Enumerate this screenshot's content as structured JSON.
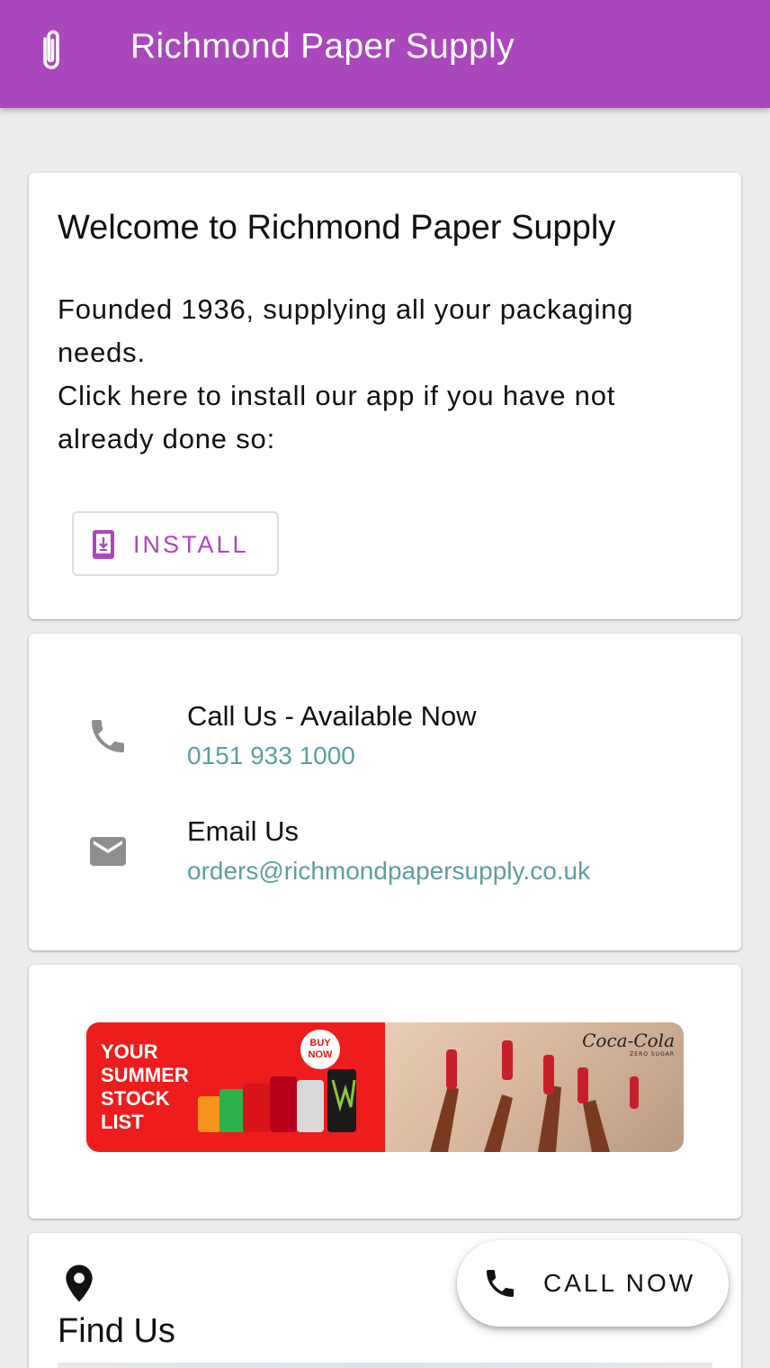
{
  "app": {
    "title": "Richmond Paper Supply",
    "accent_color": "#ab47bc",
    "link_color": "#5f9ea0"
  },
  "welcome": {
    "title": "Welcome to Richmond Paper Supply",
    "body_line1": "Founded 1936, supplying all your packaging needs.",
    "body_line2": "Click here to install our app if you have not already done so:",
    "install_label": "INSTALL",
    "install_icon": "install-mobile-icon"
  },
  "contact": {
    "call_title": "Call Us - Available Now",
    "call_number": "0151 933 1000",
    "call_icon": "phone-icon",
    "email_title": "Email Us",
    "email_address": "orders@richmondpapersupply.co.uk",
    "email_icon": "mail-icon"
  },
  "promo": {
    "headline": "YOUR\nSUMMER\nSTOCK\nLIST",
    "badge": "BUY NOW",
    "brand": "Coca-Cola",
    "brand_sub": "ZERO SUGAR"
  },
  "find_us": {
    "title": "Find Us",
    "icon": "location-pin-icon"
  },
  "fab": {
    "label": "CALL NOW",
    "icon": "phone-icon"
  }
}
